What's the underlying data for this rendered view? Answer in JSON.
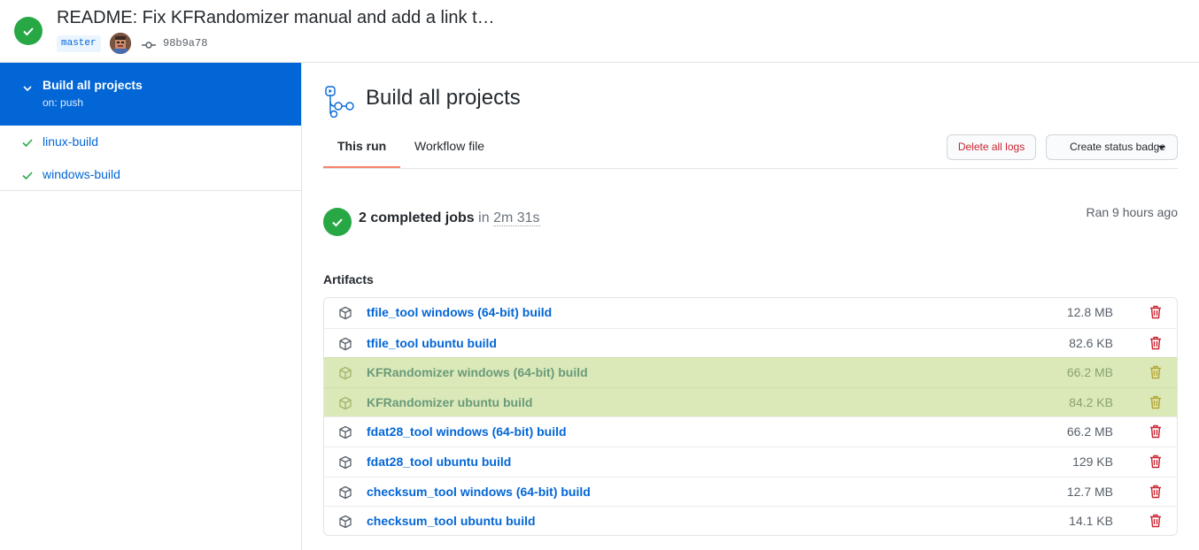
{
  "header": {
    "title": "README: Fix KFRandomizer manual and add a link t…",
    "branch": "master",
    "commit_sha": "98b9a78"
  },
  "sidebar": {
    "workflow": {
      "name": "Build all projects",
      "trigger": "on: push"
    },
    "jobs": [
      {
        "label": "linux-build"
      },
      {
        "label": "windows-build"
      }
    ]
  },
  "main": {
    "title": "Build all projects",
    "tabs": [
      {
        "label": "This run",
        "active": true
      },
      {
        "label": "Workflow file",
        "active": false
      }
    ],
    "delete_logs_label": "Delete all logs",
    "status_badge_label": "Create status badge",
    "summary": {
      "jobs_label": "2 completed jobs",
      "in_label": "in",
      "duration": "2m 31s",
      "ran": "Ran 9 hours ago"
    },
    "artifacts_heading": "Artifacts",
    "artifacts": [
      {
        "name": "tfile_tool windows (64-bit) build",
        "size": "12.8 MB",
        "expired": false
      },
      {
        "name": "tfile_tool ubuntu build",
        "size": "82.6 KB",
        "expired": false
      },
      {
        "name": "KFRandomizer windows (64-bit) build",
        "size": "66.2 MB",
        "expired": true
      },
      {
        "name": "KFRandomizer ubuntu build",
        "size": "84.2 KB",
        "expired": true
      },
      {
        "name": "fdat28_tool windows (64-bit) build",
        "size": "66.2 MB",
        "expired": false
      },
      {
        "name": "fdat28_tool ubuntu build",
        "size": "129 KB",
        "expired": false
      },
      {
        "name": "checksum_tool windows (64-bit) build",
        "size": "12.7 MB",
        "expired": false
      },
      {
        "name": "checksum_tool ubuntu build",
        "size": "14.1 KB",
        "expired": false
      }
    ]
  },
  "colors": {
    "accent": "#0366d6",
    "success": "#28a745",
    "danger": "#cb2431",
    "highlight": "#dbe9b9",
    "tab_underline": "#f9826c"
  }
}
